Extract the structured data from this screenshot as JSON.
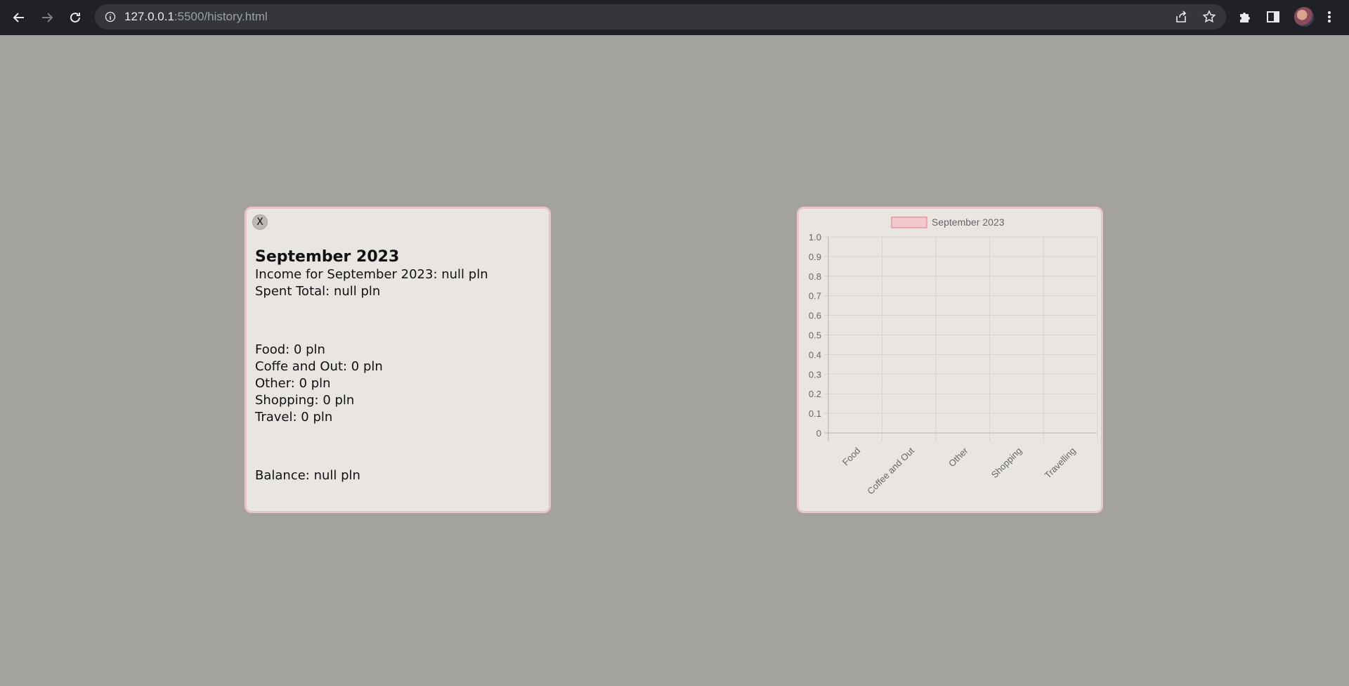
{
  "browser": {
    "url_host": "127.0.0.1",
    "url_path": ":5500/history.html"
  },
  "summary": {
    "close_label": "X",
    "title": "September 2023",
    "income": "Income for September 2023: null pln",
    "spent": "Spent Total: null pln",
    "categories": [
      "Food: 0 pln",
      "Coffe and Out: 0 pln",
      "Other: 0 pln",
      "Shopping: 0 pln",
      "Travel: 0 pln"
    ],
    "balance": "Balance: null pln"
  },
  "colors": {
    "page_bg": "#a4a29d",
    "card_bg": "#e9e6e2",
    "card_border": "#e8c4c9",
    "legend_fill": "#f2c9cf",
    "legend_stroke": "#e8728a"
  },
  "chart_data": {
    "type": "bar",
    "legend": [
      "September 2023"
    ],
    "categories": [
      "Food",
      "Coffee and Out",
      "Other",
      "Shopping",
      "Travelling"
    ],
    "series": [
      {
        "name": "September 2023",
        "values": [
          0,
          0,
          0,
          0,
          0
        ]
      }
    ],
    "ylim": [
      0,
      1.0
    ],
    "yticks": [
      "0",
      "0.1",
      "0.2",
      "0.3",
      "0.4",
      "0.5",
      "0.6",
      "0.7",
      "0.8",
      "0.9",
      "1.0"
    ],
    "grid": true,
    "legend_position": "top"
  }
}
